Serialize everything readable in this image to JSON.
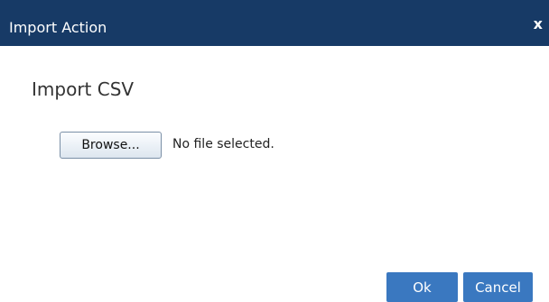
{
  "dialog": {
    "title": "Import Action",
    "close_label": "x"
  },
  "main": {
    "heading": "Import CSV",
    "browse_label": "Browse...",
    "file_status": "No file selected."
  },
  "footer": {
    "ok_label": "Ok",
    "cancel_label": "Cancel"
  },
  "colors": {
    "titlebar": "#173a66",
    "primary_button": "#3a78c0"
  }
}
